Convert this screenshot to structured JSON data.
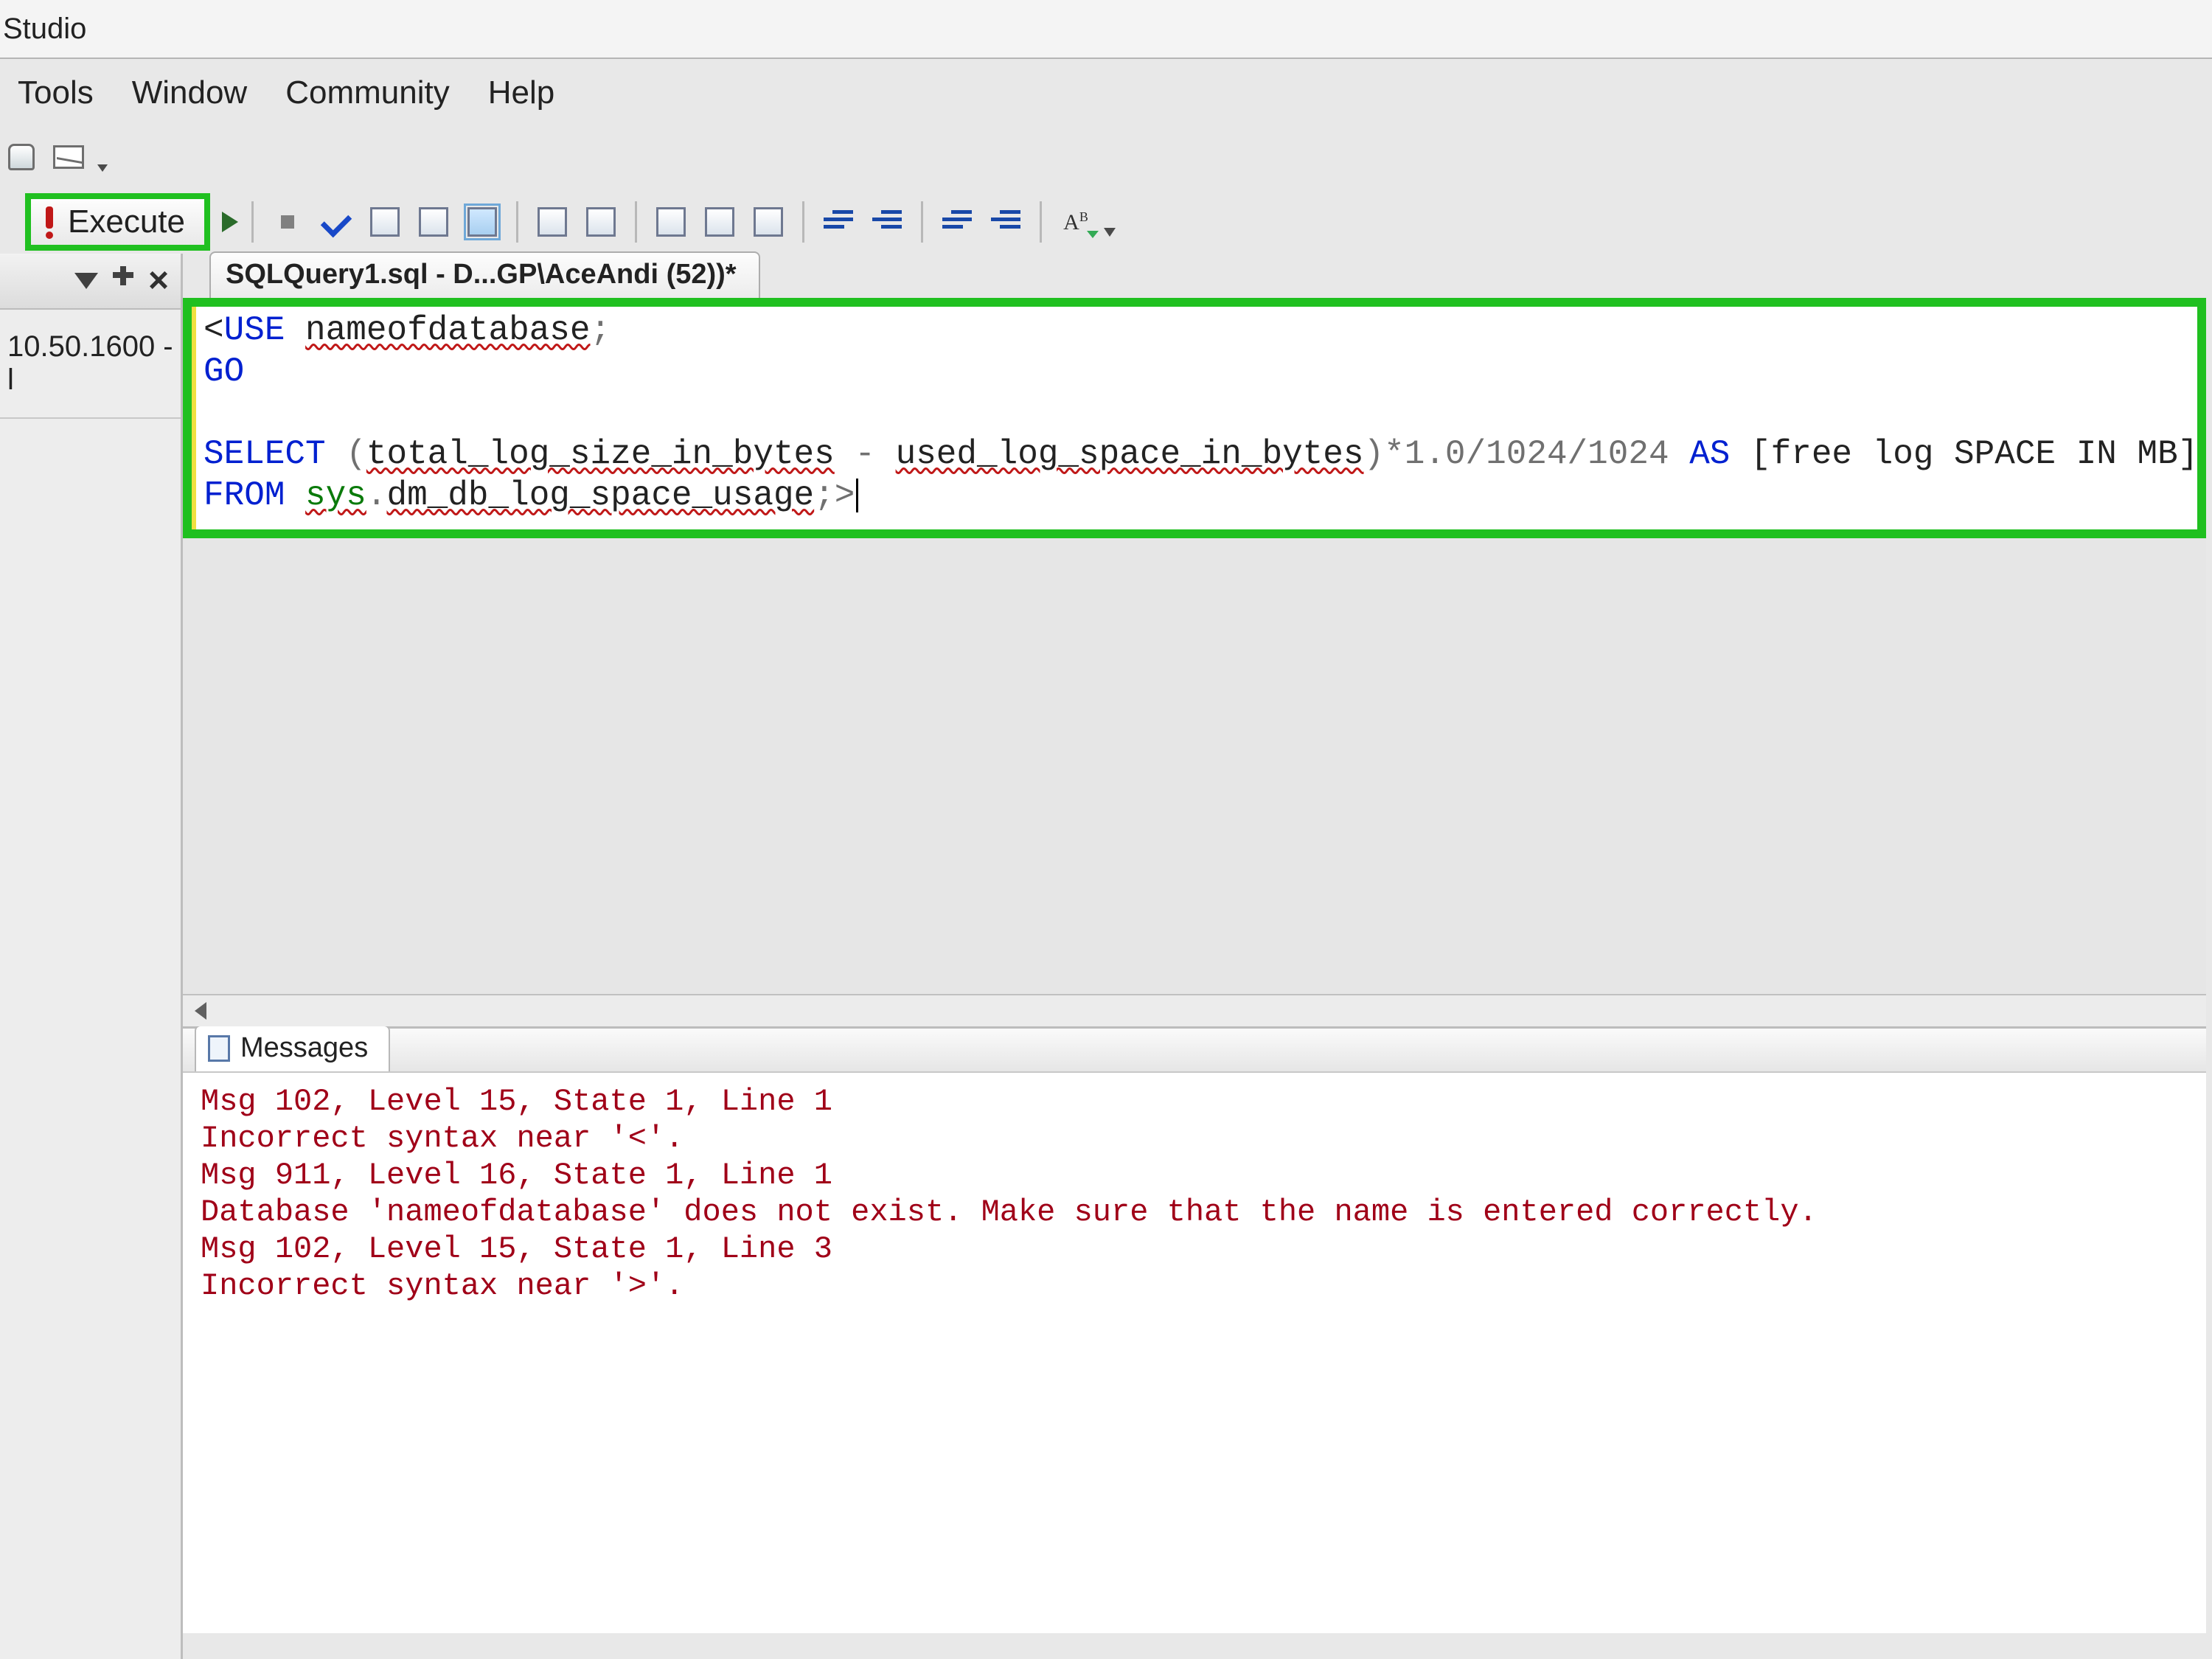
{
  "title": "Studio",
  "menu": {
    "tools": "Tools",
    "window": "Window",
    "community": "Community",
    "help": "Help"
  },
  "toolbar2": {
    "execute_label": "Execute"
  },
  "left_panel": {
    "server_text": "10.50.1600 - l"
  },
  "tab": {
    "label": "SQLQuery1.sql - D...GP\\AceAndi (52))*"
  },
  "sql": {
    "line1": {
      "pre": "<",
      "kw_use": "USE",
      "sp": " ",
      "dbname": "nameofdatabase",
      "semi": ";"
    },
    "line2": "GO",
    "line3": "",
    "line4": {
      "kw_select": "SELECT",
      "sp1": " ",
      "open": "(",
      "total": "total_log_size_in_bytes",
      "minus": " - ",
      "used": "used_log_space_in_bytes",
      "close": ")",
      "calc": "*1.0/1024/1024 ",
      "kw_as": "AS",
      "sp3": " ",
      "alias": "[free log SPACE IN MB]"
    },
    "line5": {
      "kw_from": "FROM",
      "sp": " ",
      "sys": "sys",
      "dot": ".",
      "view": "dm_db_log_space_usage",
      "semi": ";",
      "gt": ">"
    }
  },
  "messages": {
    "tab_label": "Messages",
    "lines": [
      "Msg 102, Level 15, State 1, Line 1",
      "Incorrect syntax near '<'.",
      "Msg 911, Level 16, State 1, Line 1",
      "Database 'nameofdatabase' does not exist. Make sure that the name is entered correctly.",
      "Msg 102, Level 15, State 1, Line 3",
      "Incorrect syntax near '>'."
    ]
  }
}
